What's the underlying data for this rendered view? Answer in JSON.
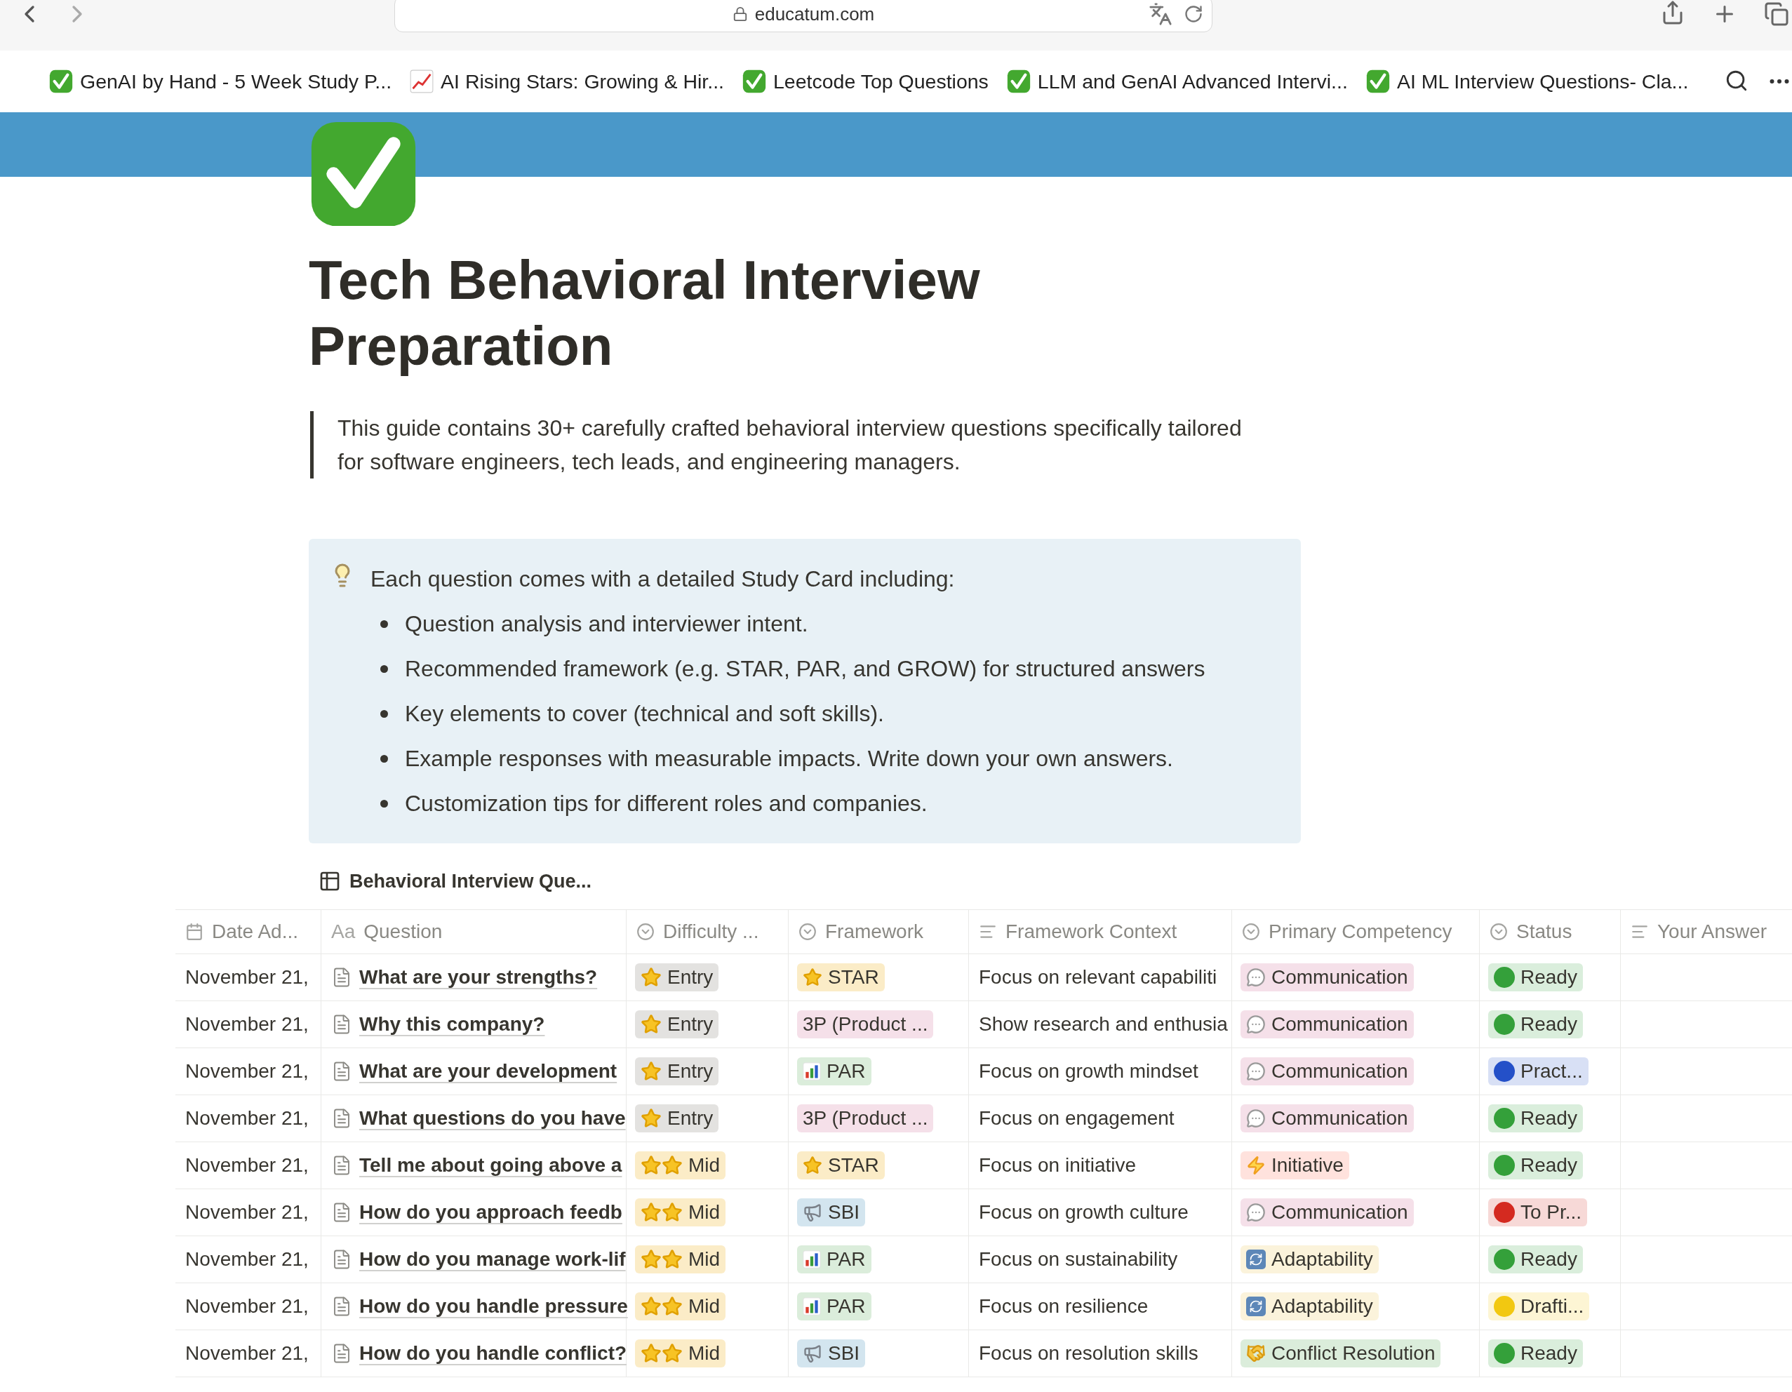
{
  "browser": {
    "url": "educatum.com"
  },
  "bookmarks": [
    {
      "label": "GenAI by Hand - 5 Week Study P...",
      "kind": "check"
    },
    {
      "label": "AI Rising Stars: Growing & Hir...",
      "kind": "chart"
    },
    {
      "label": "Leetcode Top Questions",
      "kind": "check"
    },
    {
      "label": "LLM and GenAI Advanced Intervi...",
      "kind": "check"
    },
    {
      "label": "AI ML Interview Questions- Cla...",
      "kind": "check"
    }
  ],
  "page": {
    "title": "Tech Behavioral Interview Preparation",
    "quote": "This guide contains 30+ carefully crafted behavioral interview questions specifically tailored for software engineers, tech leads, and engineering managers.",
    "callout": {
      "text": "Each question comes with a detailed Study Card including:",
      "items": [
        "Question analysis and interviewer intent.",
        "Recommended framework (e.g. STAR, PAR, and GROW) for structured answers",
        "Key elements to cover (technical and soft skills).",
        "Example responses with measurable impacts. Write down your own answers.",
        "Customization tips for different roles and companies."
      ]
    }
  },
  "database": {
    "title": "Behavioral Interview Que...",
    "columns": [
      {
        "label": "Date Ad...",
        "kind": "date"
      },
      {
        "label": "Question",
        "kind": "title",
        "prefix": "Aa"
      },
      {
        "label": "Difficulty ...",
        "kind": "select"
      },
      {
        "label": "Framework",
        "kind": "select"
      },
      {
        "label": "Framework Context",
        "kind": "text"
      },
      {
        "label": "Primary Competency",
        "kind": "select"
      },
      {
        "label": "Status",
        "kind": "select"
      },
      {
        "label": "Your Answer",
        "kind": "text"
      }
    ],
    "rows": [
      {
        "date": "November 21,",
        "question": "What are your strengths?",
        "difficulty": {
          "label": "Entry",
          "kind": "one-star",
          "color": "#e3e2e0"
        },
        "framework": {
          "label": "STAR",
          "kind": "star",
          "color": "#fbecc7"
        },
        "context": "Focus on relevant capabiliti",
        "competency": {
          "label": "Communication",
          "kind": "speech",
          "color": "#f5e0e9"
        },
        "status": {
          "label": "Ready",
          "color": "#34a03a"
        }
      },
      {
        "date": "November 21,",
        "question": "Why this company?",
        "difficulty": {
          "label": "Entry",
          "kind": "one-star",
          "color": "#e3e2e0"
        },
        "framework": {
          "label": "3P (Product ...",
          "kind": "none",
          "color": "#f5e0e9"
        },
        "context": "Show research and enthusia",
        "competency": {
          "label": "Communication",
          "kind": "speech",
          "color": "#f5e0e9"
        },
        "status": {
          "label": "Ready",
          "color": "#34a03a"
        }
      },
      {
        "date": "November 21,",
        "question": "What are your development",
        "difficulty": {
          "label": "Entry",
          "kind": "one-star",
          "color": "#e3e2e0"
        },
        "framework": {
          "label": "PAR",
          "kind": "chart",
          "color": "#dbeddb"
        },
        "context": "Focus on growth mindset",
        "competency": {
          "label": "Communication",
          "kind": "speech",
          "color": "#f5e0e9"
        },
        "status": {
          "label": "Pract...",
          "color": "#2450c8"
        }
      },
      {
        "date": "November 21,",
        "question": "What questions do you have",
        "difficulty": {
          "label": "Entry",
          "kind": "one-star",
          "color": "#e3e2e0"
        },
        "framework": {
          "label": "3P (Product ...",
          "kind": "none",
          "color": "#f5e0e9"
        },
        "context": "Focus on engagement",
        "competency": {
          "label": "Communication",
          "kind": "speech",
          "color": "#f5e0e9"
        },
        "status": {
          "label": "Ready",
          "color": "#34a03a"
        }
      },
      {
        "date": "November 21,",
        "question": "Tell me about going above a",
        "difficulty": {
          "label": "Mid",
          "kind": "two-star",
          "color": "#fbecc7"
        },
        "framework": {
          "label": "STAR",
          "kind": "star",
          "color": "#fbecc7"
        },
        "context": "Focus on initiative",
        "competency": {
          "label": "Initiative",
          "kind": "bolt",
          "color": "#ffe2dd"
        },
        "status": {
          "label": "Ready",
          "color": "#34a03a"
        }
      },
      {
        "date": "November 21,",
        "question": "How do you approach feedb",
        "difficulty": {
          "label": "Mid",
          "kind": "two-star",
          "color": "#fbecc7"
        },
        "framework": {
          "label": "SBI",
          "kind": "megaphone",
          "color": "#d3e5ef"
        },
        "context": "Focus on growth culture",
        "competency": {
          "label": "Communication",
          "kind": "speech",
          "color": "#f5e0e9"
        },
        "status": {
          "label": "To Pr...",
          "color": "#d42a20"
        }
      },
      {
        "date": "November 21,",
        "question": "How do you manage work-lif",
        "difficulty": {
          "label": "Mid",
          "kind": "two-star",
          "color": "#fbecc7"
        },
        "framework": {
          "label": "PAR",
          "kind": "chart",
          "color": "#dbeddb"
        },
        "context": "Focus on sustainability",
        "competency": {
          "label": "Adaptability",
          "kind": "cycle",
          "color": "#fbf3db"
        },
        "status": {
          "label": "Ready",
          "color": "#34a03a"
        }
      },
      {
        "date": "November 21,",
        "question": "How do you handle pressure",
        "difficulty": {
          "label": "Mid",
          "kind": "two-star",
          "color": "#fbecc7"
        },
        "framework": {
          "label": "PAR",
          "kind": "chart",
          "color": "#dbeddb"
        },
        "context": "Focus on resilience",
        "competency": {
          "label": "Adaptability",
          "kind": "cycle",
          "color": "#fbf3db"
        },
        "status": {
          "label": "Drafti...",
          "color": "#f2c811"
        }
      },
      {
        "date": "November 21,",
        "question": "How do you handle conflict?",
        "difficulty": {
          "label": "Mid",
          "kind": "two-star",
          "color": "#fbecc7"
        },
        "framework": {
          "label": "SBI",
          "kind": "megaphone",
          "color": "#d3e5ef"
        },
        "context": "Focus on resolution skills",
        "competency": {
          "label": "Conflict Resolution",
          "kind": "handshake",
          "color": "#dbeddb"
        },
        "status": {
          "label": "Ready",
          "color": "#34a03a"
        }
      }
    ]
  }
}
